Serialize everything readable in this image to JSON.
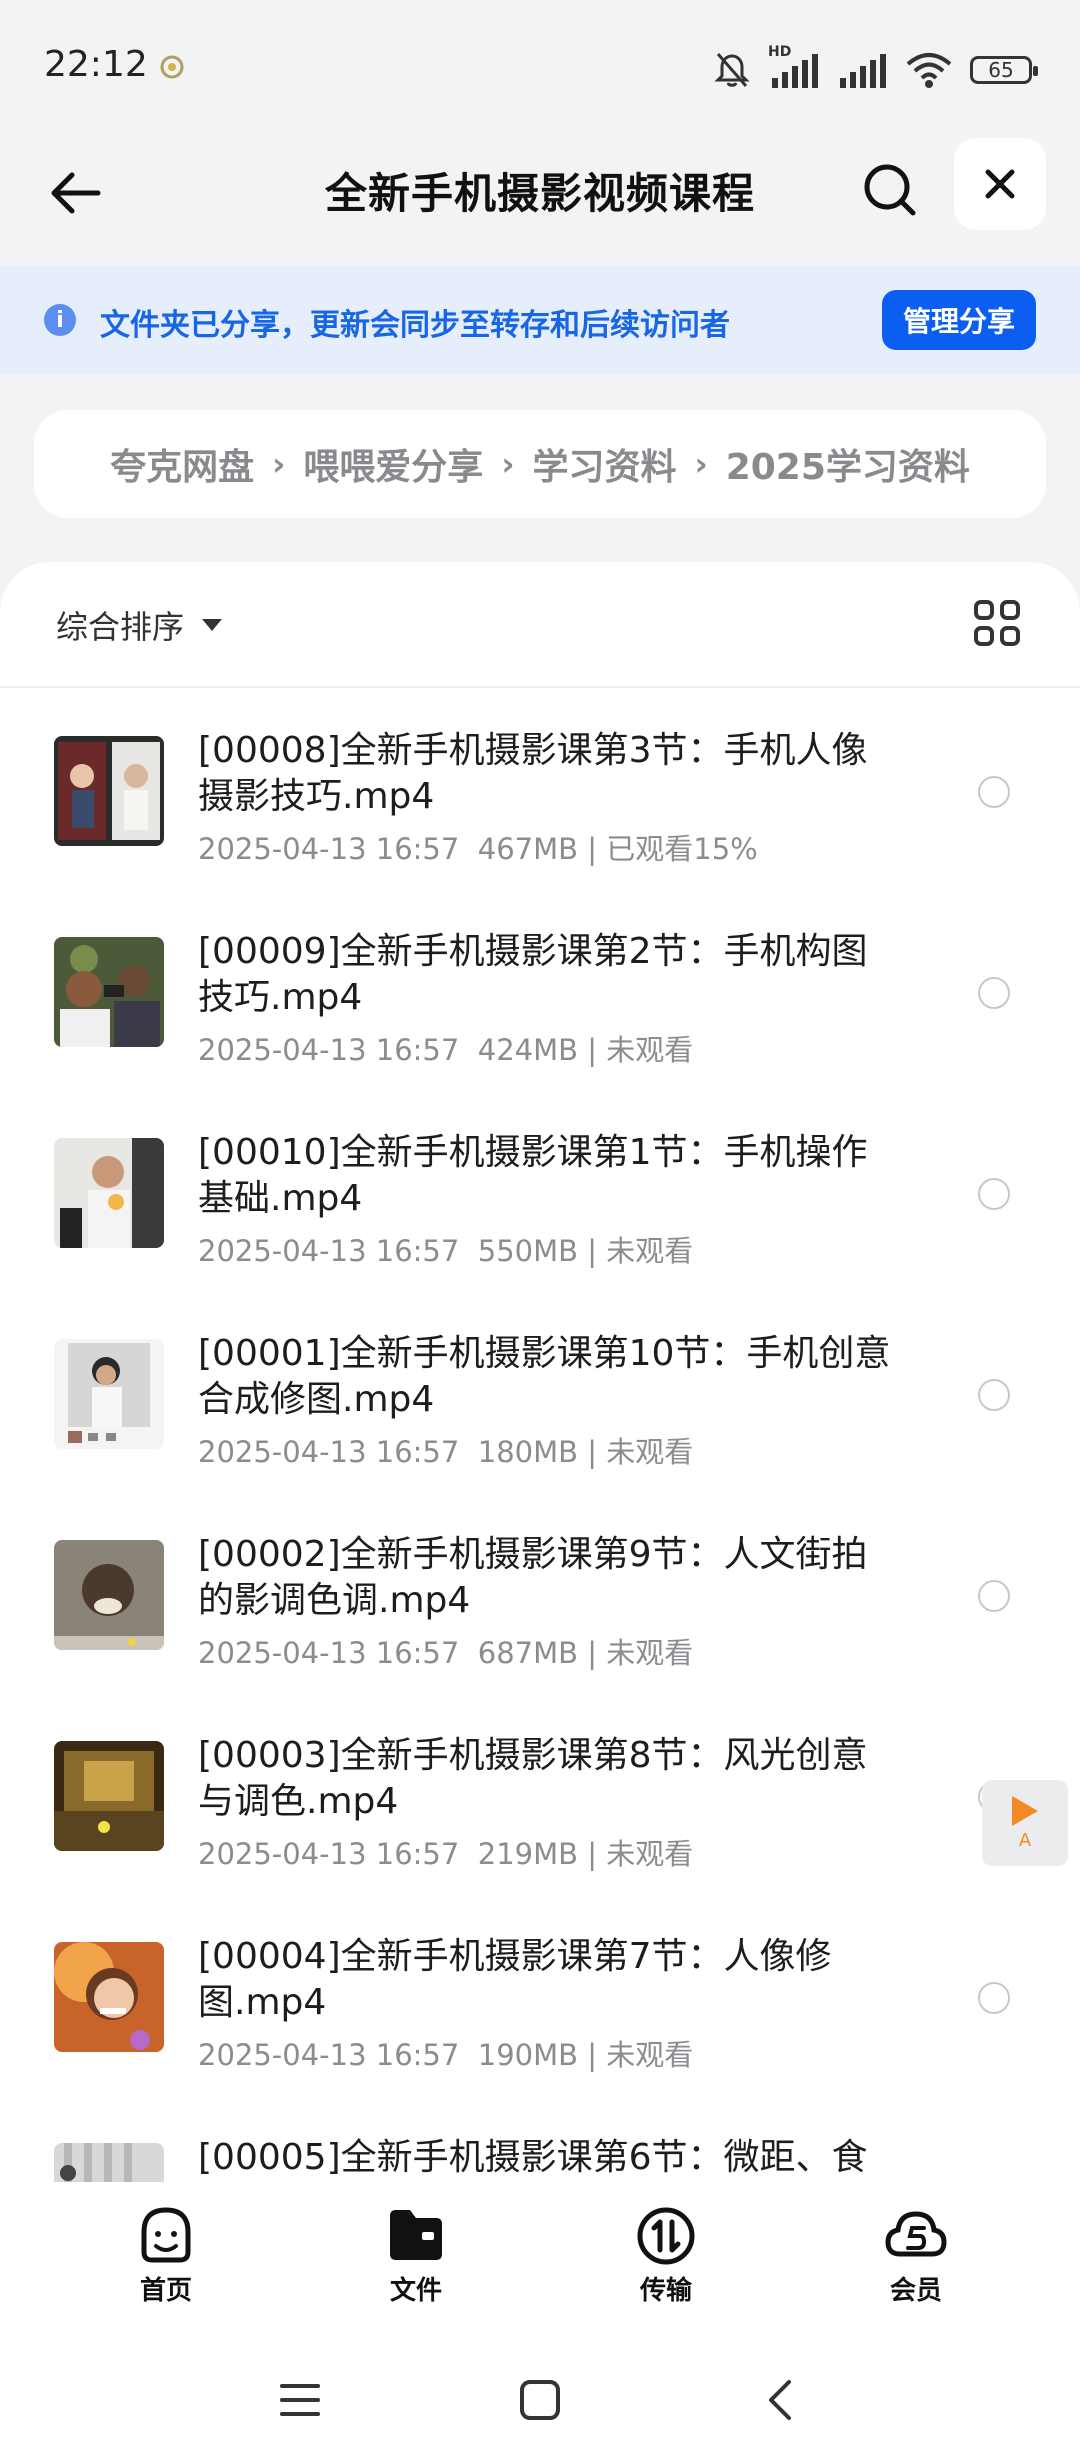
{
  "status_bar": {
    "time": "22:12",
    "signal_label": "HD",
    "battery": "65"
  },
  "nav": {
    "title": "全新手机摄影视频课程",
    "back_icon": "back-arrow-icon",
    "search_icon": "search-icon",
    "close_icon": "close-icon"
  },
  "banner": {
    "text": "文件夹已分享，更新会同步至转存和后续访问者",
    "info_icon": "i",
    "manage_label": "管理分享"
  },
  "breadcrumb": [
    "夸克网盘",
    "喂喂爱分享",
    "学习资料",
    "2025学习资料"
  ],
  "sort": {
    "label": "综合排序"
  },
  "files": [
    {
      "name": "[00008]全新手机摄影课第3节：手机人像摄影技巧.mp4",
      "date": "2025-04-13 16:57",
      "size": "467MB",
      "watch": "已观看15%"
    },
    {
      "name": "[00009]全新手机摄影课第2节：手机构图技巧.mp4",
      "date": "2025-04-13 16:57",
      "size": "424MB",
      "watch": "未观看"
    },
    {
      "name": "[00010]全新手机摄影课第1节：手机操作基础.mp4",
      "date": "2025-04-13 16:57",
      "size": "550MB",
      "watch": "未观看"
    },
    {
      "name": "[00001]全新手机摄影课第10节：手机创意合成修图.mp4",
      "date": "2025-04-13 16:57",
      "size": "180MB",
      "watch": "未观看"
    },
    {
      "name": "[00002]全新手机摄影课第9节：人文街拍的影调色调.mp4",
      "date": "2025-04-13 16:57",
      "size": "687MB",
      "watch": "未观看"
    },
    {
      "name": "[00003]全新手机摄影课第8节：风光创意与调色.mp4",
      "date": "2025-04-13 16:57",
      "size": "219MB",
      "watch": "未观看"
    },
    {
      "name": "[00004]全新手机摄影课第7节：人像修图.mp4",
      "date": "2025-04-13 16:57",
      "size": "190MB",
      "watch": "未观看"
    },
    {
      "name": "[00005]全新手机摄影课第6节：微距、食",
      "date": "",
      "size": "",
      "watch": ""
    }
  ],
  "float_button": {
    "label": "A"
  },
  "tabs": [
    {
      "label": "首页",
      "icon": "home-face-icon"
    },
    {
      "label": "文件",
      "icon": "folder-icon"
    },
    {
      "label": "传输",
      "icon": "transfer-icon"
    },
    {
      "label": "会员",
      "icon": "member-cloud-icon"
    }
  ],
  "colors": {
    "accent": "#0b5ef0",
    "banner_bg": "#e6edfb",
    "banner_text": "#1766e6"
  }
}
